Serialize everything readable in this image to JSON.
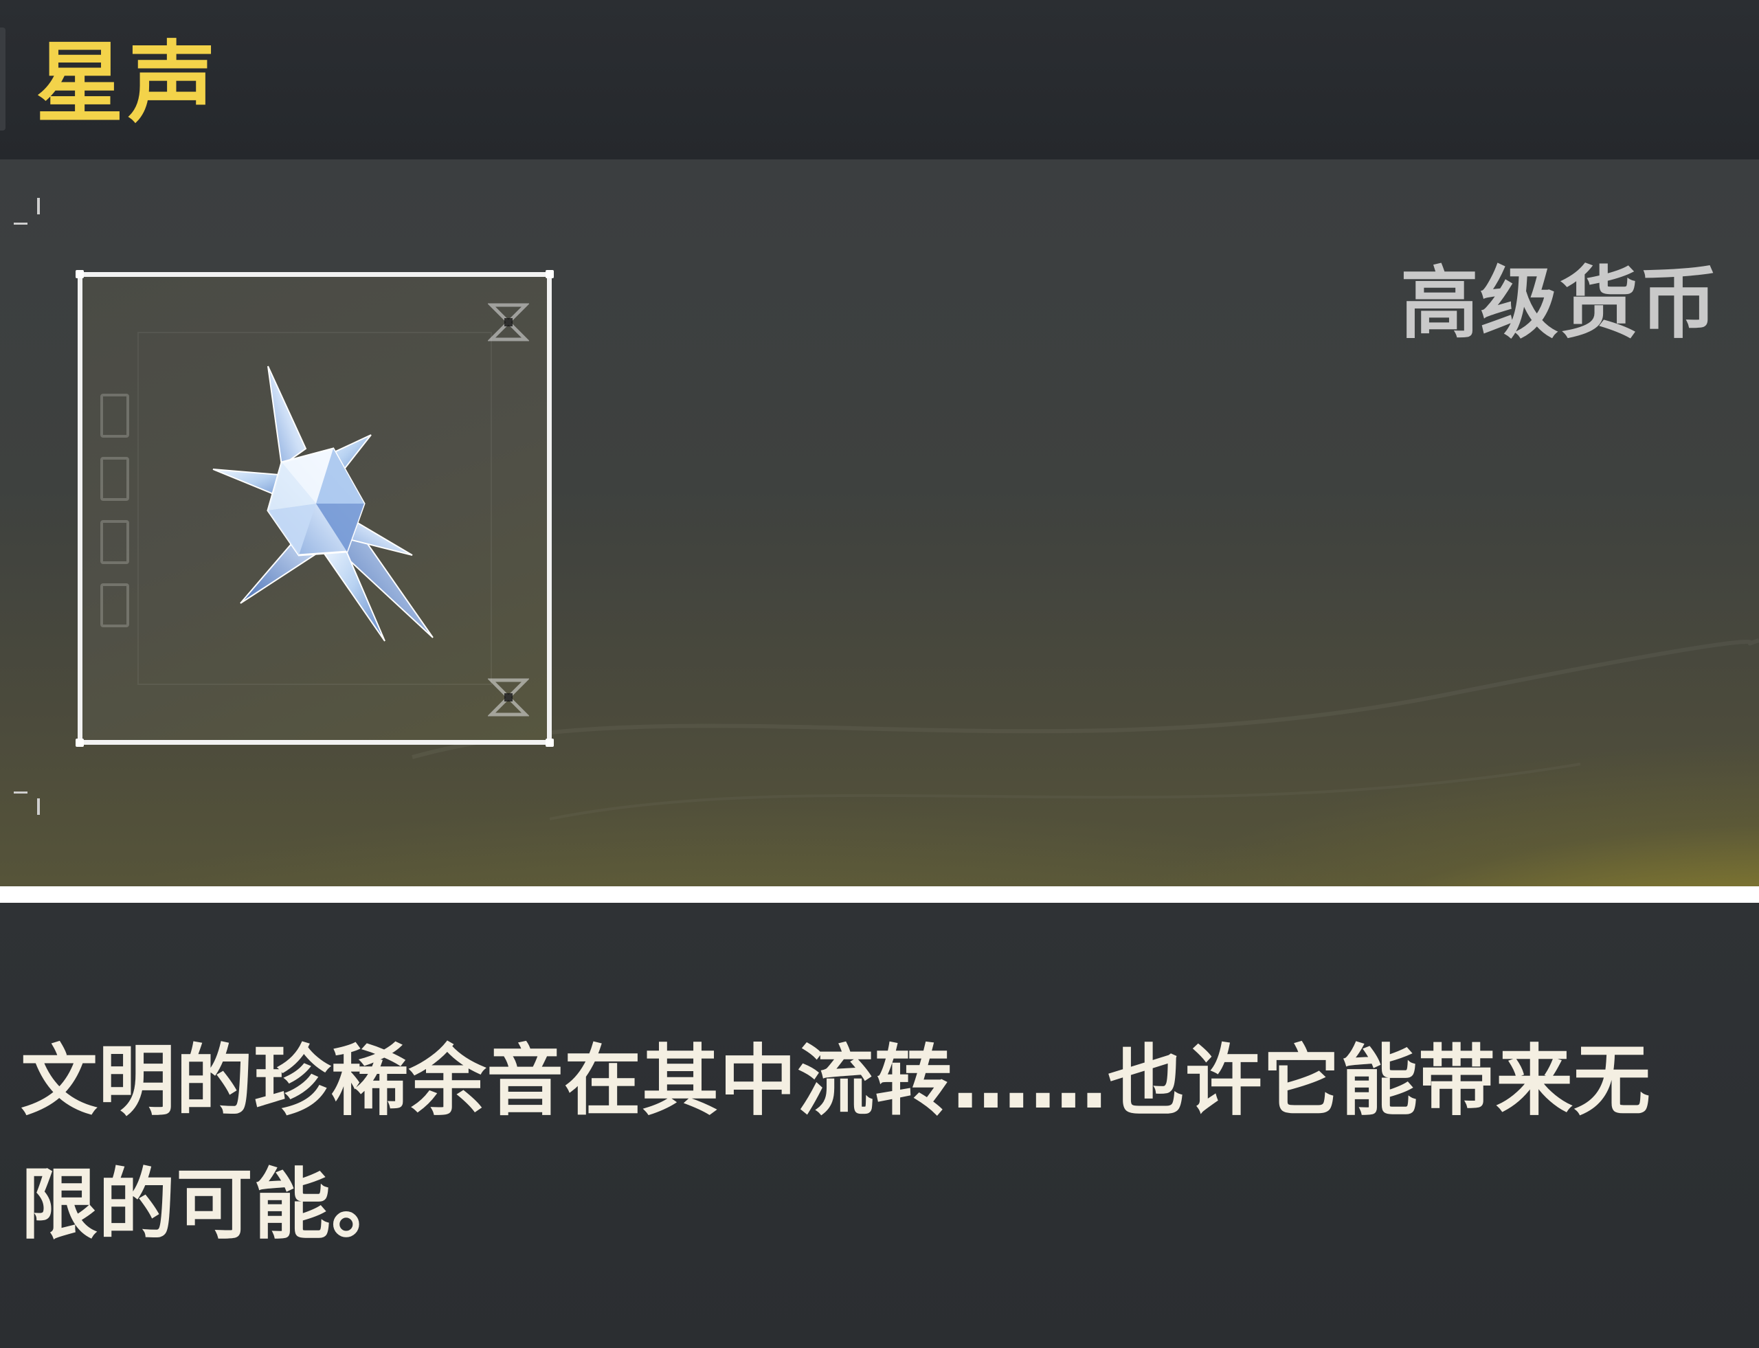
{
  "item": {
    "name": "星声",
    "category": "高级货币",
    "icon": "crystal-star-icon",
    "description": "文明的珍稀余音在其中流转……也许它能带来无限的可能。"
  },
  "colors": {
    "title": "#f3d34a",
    "category": "#c9c9c9",
    "description": "#f4efe2",
    "accent_glow": "#d6c42e"
  }
}
